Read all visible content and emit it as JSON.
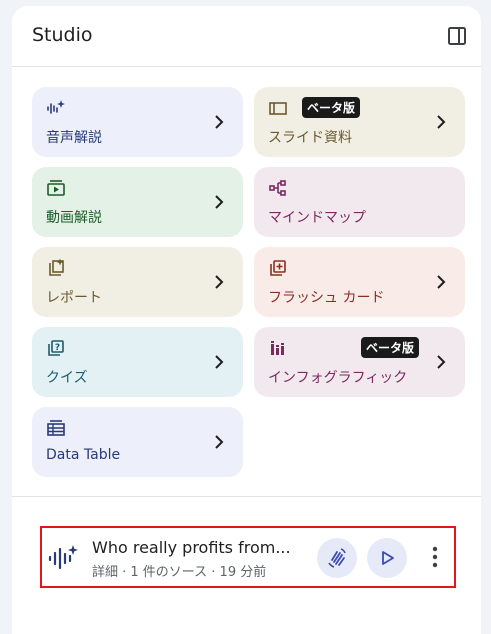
{
  "header": {
    "title": "Studio",
    "toggle_icon": "side-panel-icon"
  },
  "cards": [
    {
      "label": "音声解説",
      "icon": "audio-sparkle-icon",
      "bg": "#edeffa",
      "color": "#29397a",
      "badge": ""
    },
    {
      "label": "スライド資料",
      "icon": "slides-icon",
      "bg": "#f1efe4",
      "color": "#6b5a2d",
      "badge": "ベータ版"
    },
    {
      "label": "動画解説",
      "icon": "video-icon",
      "bg": "#e4f1e6",
      "color": "#1e5b2a",
      "badge": ""
    },
    {
      "label": "マインドマップ",
      "icon": "mindmap-icon",
      "bg": "#f2e9ef",
      "color": "#7a2a5f",
      "badge": ""
    },
    {
      "label": "レポート",
      "icon": "report-icon",
      "bg": "#f1efe4",
      "color": "#6b5a2d",
      "badge": ""
    },
    {
      "label": "フラッシュ カード",
      "icon": "flashcards-icon",
      "bg": "#f8ebe8",
      "color": "#8a2e22",
      "badge": ""
    },
    {
      "label": "クイズ",
      "icon": "quiz-icon",
      "bg": "#e3f1f5",
      "color": "#1f5b6b",
      "badge": ""
    },
    {
      "label": "インフォグラフィック",
      "icon": "infographic-icon",
      "bg": "#f2e9ef",
      "color": "#7a2a5f",
      "badge": "ベータ版"
    },
    {
      "label": "Data Table",
      "icon": "table-icon",
      "bg": "#edeffa",
      "color": "#29397a",
      "badge": ""
    }
  ],
  "note": {
    "title": "Who really profits from...",
    "subtitle": "詳細 · 1 件のソース · 19 分前",
    "icons": [
      "audio-wave-icon",
      "interactive-icon",
      "play-icon",
      "more-vert-icon"
    ]
  }
}
